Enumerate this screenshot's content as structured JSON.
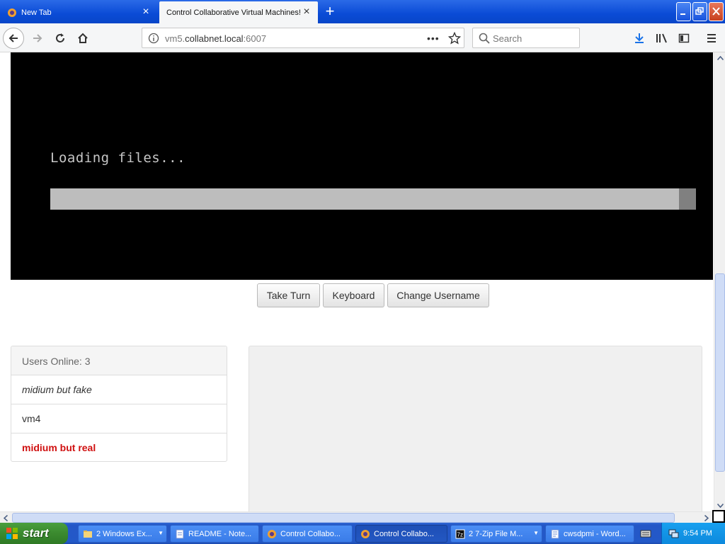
{
  "browser": {
    "tabs": [
      {
        "title": "New Tab",
        "active": false
      },
      {
        "title": "Control Collaborative Virtual Machines!",
        "active": true
      }
    ],
    "url": {
      "host_prefix": "vm5.",
      "host_main": "collabnet.local",
      "port": ":6007"
    },
    "search": {
      "placeholder": "Search"
    }
  },
  "vm": {
    "message": "Loading files...",
    "progress": 0.974
  },
  "controls": {
    "take_turn": "Take Turn",
    "keyboard": "Keyboard",
    "change_username": "Change Username"
  },
  "users": {
    "header": "Users Online: 3",
    "list": [
      {
        "name": "midium but fake"
      },
      {
        "name": "vm4"
      },
      {
        "name": "midium but real"
      }
    ]
  },
  "taskbar": {
    "start_label": "start",
    "tasks": [
      {
        "label": "2 Windows Ex..."
      },
      {
        "label": "README - Note..."
      },
      {
        "label": "Control Collabo..."
      },
      {
        "label": "Control Collabo..."
      },
      {
        "label": "2 7-Zip File M..."
      },
      {
        "label": "cwsdpmi - Word..."
      }
    ],
    "clock": "9:54 PM"
  }
}
